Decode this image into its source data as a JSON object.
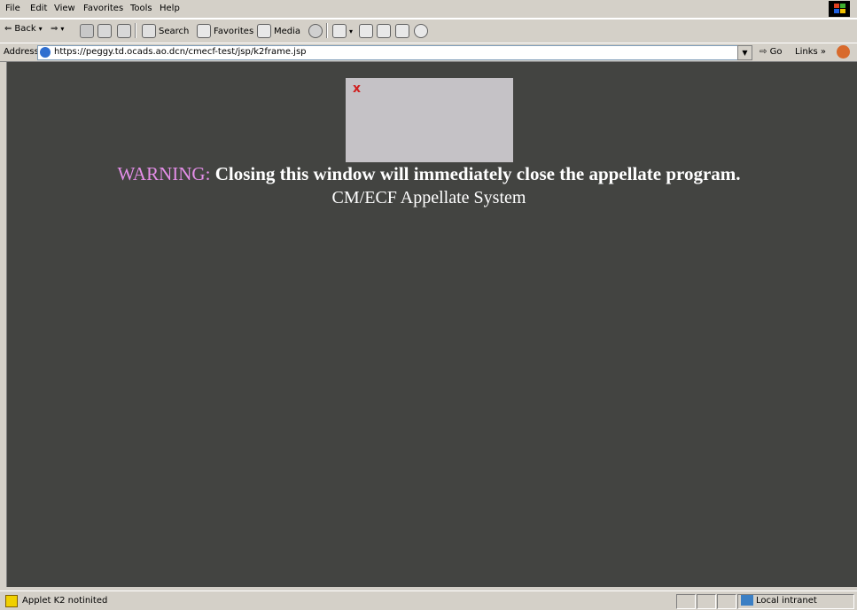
{
  "menu": [
    "File",
    "Edit",
    "View",
    "Favorites",
    "Tools",
    "Help"
  ],
  "toolbar": {
    "back": "Back",
    "search": "Search",
    "favorites": "Favorites",
    "media": "Media"
  },
  "address": {
    "label": "Address",
    "url": "https://peggy.td.ocads.ao.dcn/cmecf-test/jsp/k2frame.jsp",
    "go": "Go",
    "links": "Links"
  },
  "content": {
    "warning_label": "WARNING:",
    "warning_text": "Closing this window will immediately close the appellate program.",
    "subtitle": "CM/ECF Appellate System"
  },
  "status": {
    "text": "Applet K2 notinited",
    "zone": "Local intranet"
  }
}
